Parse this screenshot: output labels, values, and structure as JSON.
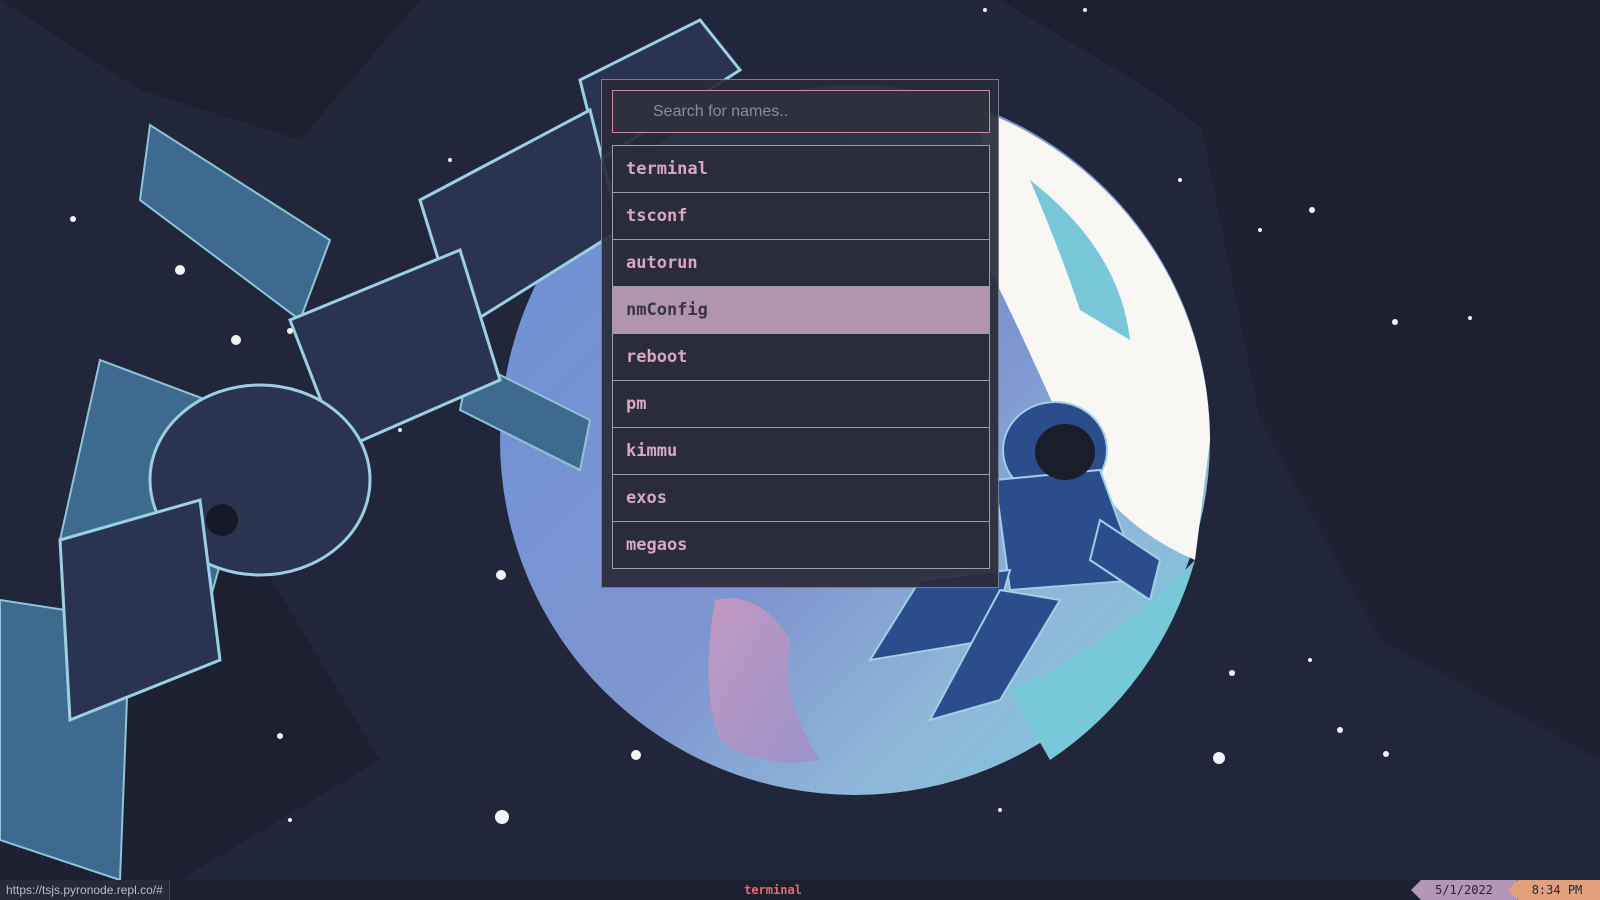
{
  "launcher": {
    "search_placeholder": "Search for names..",
    "search_value": "",
    "items": [
      {
        "label": "terminal"
      },
      {
        "label": "tsconf"
      },
      {
        "label": "autorun"
      },
      {
        "label": "nmConfig"
      },
      {
        "label": "reboot"
      },
      {
        "label": "pm"
      },
      {
        "label": "kimmu"
      },
      {
        "label": "exos"
      },
      {
        "label": "megaos"
      }
    ],
    "selected_label": "nmConfig"
  },
  "taskbar": {
    "url": "https://tsjs.pyronode.repl.co/#",
    "active_task": "terminal",
    "date": "5/1/2022",
    "time": "8:34 PM"
  },
  "colors": {
    "background": "#22263a",
    "selected_item": "#b194b0",
    "item_text": "#d8a8c0",
    "search_border": "#d08a96",
    "active_task_text": "#e26a72",
    "date_badge": "#b497b8",
    "time_badge": "#e3a07a"
  }
}
